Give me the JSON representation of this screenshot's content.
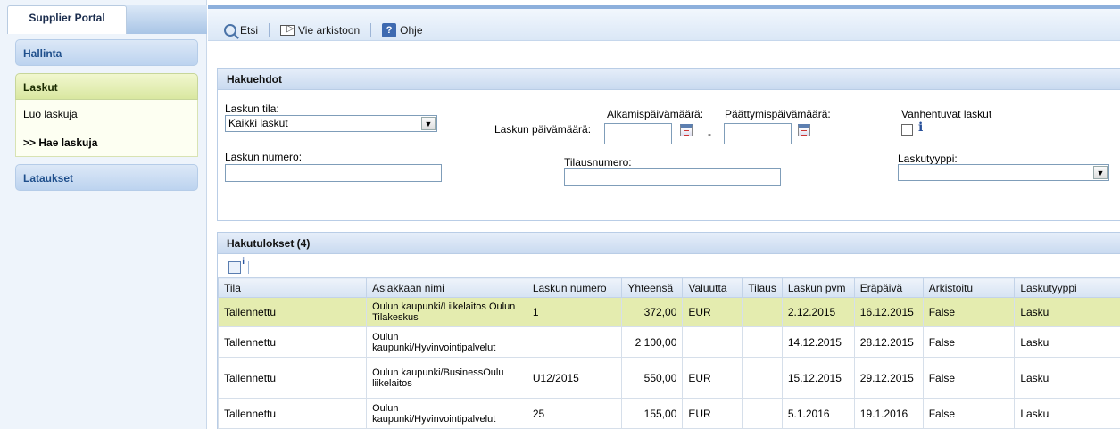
{
  "sidebar": {
    "portal_title": "Supplier Portal",
    "hallinta": "Hallinta",
    "laskut": "Laskut",
    "laskut_items": [
      "Luo laskuja",
      ">> Hae laskuja"
    ],
    "lataukset": "Lataukset"
  },
  "toolbar": {
    "search": "Etsi",
    "archive": "Vie arkistoon",
    "help": "Ohje",
    "help_glyph": "?"
  },
  "search_panel": {
    "title": "Hakuehdot",
    "status_label": "Laskun tila:",
    "status_value": "Kaikki laskut",
    "date_label": "Laskun päivämäärä:",
    "start_label": "Alkamispäivämäärä:",
    "end_label": "Päättymispäivämäärä:",
    "date_sep": "-",
    "expiring_label": "Vanhentuvat laskut",
    "info_glyph": "i",
    "invoice_number_label": "Laskun numero:",
    "order_number_label": "Tilausnumero:",
    "invoice_type_label": "Laskutyyppi:",
    "select_arrow": "▼"
  },
  "results": {
    "title": "Hakutulokset (4)",
    "columns": [
      "Tila",
      "Asiakkaan nimi",
      "Laskun numero",
      "Yhteensä",
      "Valuutta",
      "Tilaus",
      "Laskun pvm",
      "Eräpäivä",
      "Arkistoitu",
      "Laskutyyppi"
    ],
    "rows": [
      [
        "Tallennettu",
        "Oulun kaupunki/Liikelaitos Oulun Tilakeskus",
        "1",
        "372,00",
        "EUR",
        "",
        "2.12.2015",
        "16.12.2015",
        "False",
        "Lasku"
      ],
      [
        "Tallennettu",
        "Oulun kaupunki/Hyvinvointipalvelut",
        "",
        "2 100,00",
        "",
        "",
        "14.12.2015",
        "28.12.2015",
        "False",
        "Lasku"
      ],
      [
        "Tallennettu",
        "Oulun kaupunki/BusinessOulu liikelaitos",
        "U12/2015",
        "550,00",
        "EUR",
        "",
        "15.12.2015",
        "29.12.2015",
        "False",
        "Lasku"
      ],
      [
        "Tallennettu",
        "Oulun kaupunki/Hyvinvointipalvelut",
        "25",
        "155,00",
        "EUR",
        "",
        "5.1.2016",
        "19.1.2016",
        "False",
        "Lasku"
      ]
    ]
  }
}
